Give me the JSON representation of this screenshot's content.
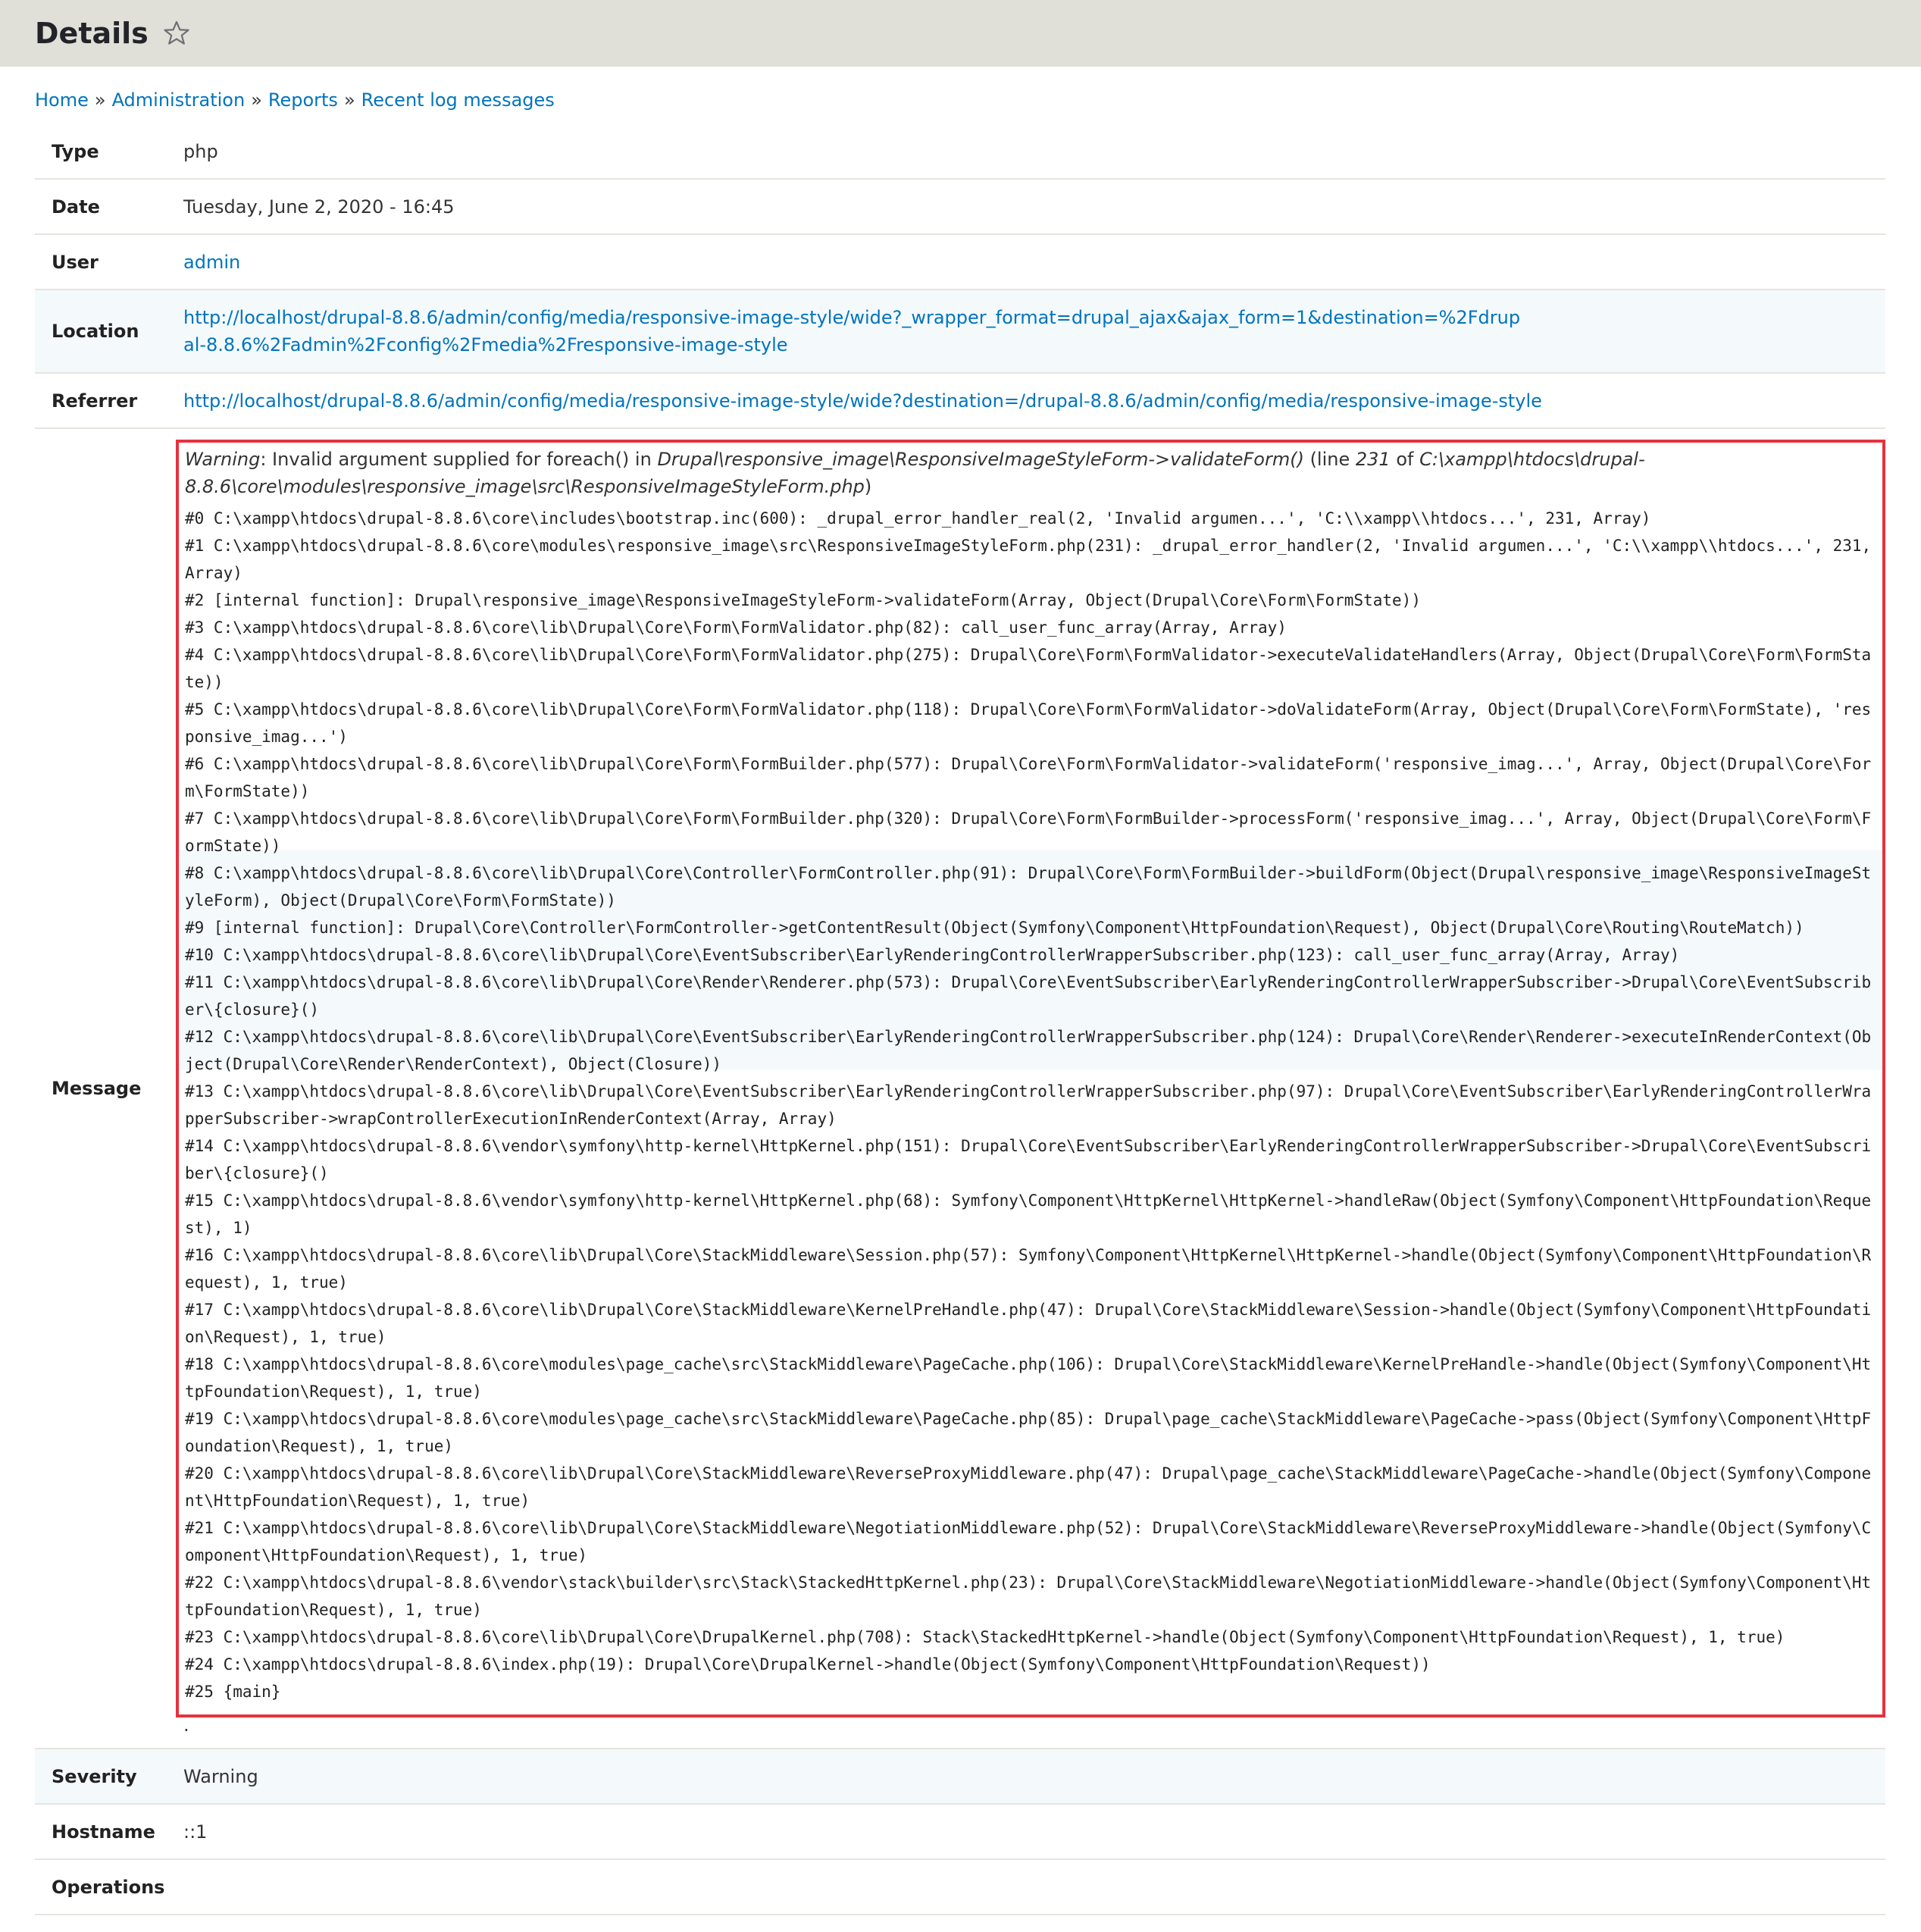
{
  "header": {
    "title": "Details",
    "star_icon": "star-outline-icon"
  },
  "breadcrumb": [
    "Home",
    "Administration",
    "Reports",
    "Recent log messages"
  ],
  "breadcrumb_sep": "»",
  "details": {
    "type": {
      "label": "Type",
      "value": "php"
    },
    "date": {
      "label": "Date",
      "value": "Tuesday, June 2, 2020 - 16:45"
    },
    "user": {
      "label": "User",
      "value": "admin"
    },
    "location": {
      "label": "Location",
      "value": "http://localhost/drupal-8.8.6/admin/config/media/responsive-image-style/wide?_wrapper_format=drupal_ajax&ajax_form=1&destination=%2Fdrupal-8.8.6%2Fadmin%2Fconfig%2Fmedia%2Fresponsive-image-style"
    },
    "referrer": {
      "label": "Referrer",
      "value": "http://localhost/drupal-8.8.6/admin/config/media/responsive-image-style/wide?destination=/drupal-8.8.6/admin/config/media/responsive-image-style"
    },
    "message": {
      "label": "Message",
      "warning_prefix": "Warning",
      "warning_text": ": Invalid argument supplied for foreach() in ",
      "warning_function": "Drupal\\responsive_image\\ResponsiveImageStyleForm->validateForm()",
      "warning_line_pre": " (line ",
      "warning_line": "231",
      "warning_of": " of ",
      "warning_file": "C:\\xampp\\htdocs\\drupal-8.8.6\\core\\modules\\responsive_image\\src\\ResponsiveImageStyleForm.php",
      "warning_close": ")",
      "trace": [
        "#0 C:\\xampp\\htdocs\\drupal-8.8.6\\core\\includes\\bootstrap.inc(600): _drupal_error_handler_real(2, 'Invalid argumen...', 'C:\\\\xampp\\\\htdocs...', 231, Array)",
        "#1 C:\\xampp\\htdocs\\drupal-8.8.6\\core\\modules\\responsive_image\\src\\ResponsiveImageStyleForm.php(231): _drupal_error_handler(2, 'Invalid argumen...', 'C:\\\\xampp\\\\htdocs...', 231, Array)",
        "#2 [internal function]: Drupal\\responsive_image\\ResponsiveImageStyleForm->validateForm(Array, Object(Drupal\\Core\\Form\\FormState))",
        "#3 C:\\xampp\\htdocs\\drupal-8.8.6\\core\\lib\\Drupal\\Core\\Form\\FormValidator.php(82): call_user_func_array(Array, Array)",
        "#4 C:\\xampp\\htdocs\\drupal-8.8.6\\core\\lib\\Drupal\\Core\\Form\\FormValidator.php(275): Drupal\\Core\\Form\\FormValidator->executeValidateHandlers(Array, Object(Drupal\\Core\\Form\\FormState))",
        "#5 C:\\xampp\\htdocs\\drupal-8.8.6\\core\\lib\\Drupal\\Core\\Form\\FormValidator.php(118): Drupal\\Core\\Form\\FormValidator->doValidateForm(Array, Object(Drupal\\Core\\Form\\FormState), 'responsive_imag...')",
        "#6 C:\\xampp\\htdocs\\drupal-8.8.6\\core\\lib\\Drupal\\Core\\Form\\FormBuilder.php(577): Drupal\\Core\\Form\\FormValidator->validateForm('responsive_imag...', Array, Object(Drupal\\Core\\Form\\FormState))",
        "#7 C:\\xampp\\htdocs\\drupal-8.8.6\\core\\lib\\Drupal\\Core\\Form\\FormBuilder.php(320): Drupal\\Core\\Form\\FormBuilder->processForm('responsive_imag...', Array, Object(Drupal\\Core\\Form\\FormState))",
        "#8 C:\\xampp\\htdocs\\drupal-8.8.6\\core\\lib\\Drupal\\Core\\Controller\\FormController.php(91): Drupal\\Core\\Form\\FormBuilder->buildForm(Object(Drupal\\responsive_image\\ResponsiveImageStyleForm), Object(Drupal\\Core\\Form\\FormState))",
        "#9 [internal function]: Drupal\\Core\\Controller\\FormController->getContentResult(Object(Symfony\\Component\\HttpFoundation\\Request), Object(Drupal\\Core\\Routing\\RouteMatch))",
        "#10 C:\\xampp\\htdocs\\drupal-8.8.6\\core\\lib\\Drupal\\Core\\EventSubscriber\\EarlyRenderingControllerWrapperSubscriber.php(123): call_user_func_array(Array, Array)",
        "#11 C:\\xampp\\htdocs\\drupal-8.8.6\\core\\lib\\Drupal\\Core\\Render\\Renderer.php(573): Drupal\\Core\\EventSubscriber\\EarlyRenderingControllerWrapperSubscriber->Drupal\\Core\\EventSubscriber\\{closure}()",
        "#12 C:\\xampp\\htdocs\\drupal-8.8.6\\core\\lib\\Drupal\\Core\\EventSubscriber\\EarlyRenderingControllerWrapperSubscriber.php(124): Drupal\\Core\\Render\\Renderer->executeInRenderContext(Object(Drupal\\Core\\Render\\RenderContext), Object(Closure))",
        "#13 C:\\xampp\\htdocs\\drupal-8.8.6\\core\\lib\\Drupal\\Core\\EventSubscriber\\EarlyRenderingControllerWrapperSubscriber.php(97): Drupal\\Core\\EventSubscriber\\EarlyRenderingControllerWrapperSubscriber->wrapControllerExecutionInRenderContext(Array, Array)",
        "#14 C:\\xampp\\htdocs\\drupal-8.8.6\\vendor\\symfony\\http-kernel\\HttpKernel.php(151): Drupal\\Core\\EventSubscriber\\EarlyRenderingControllerWrapperSubscriber->Drupal\\Core\\EventSubscriber\\{closure}()",
        "#15 C:\\xampp\\htdocs\\drupal-8.8.6\\vendor\\symfony\\http-kernel\\HttpKernel.php(68): Symfony\\Component\\HttpKernel\\HttpKernel->handleRaw(Object(Symfony\\Component\\HttpFoundation\\Request), 1)",
        "#16 C:\\xampp\\htdocs\\drupal-8.8.6\\core\\lib\\Drupal\\Core\\StackMiddleware\\Session.php(57): Symfony\\Component\\HttpKernel\\HttpKernel->handle(Object(Symfony\\Component\\HttpFoundation\\Request), 1, true)",
        "#17 C:\\xampp\\htdocs\\drupal-8.8.6\\core\\lib\\Drupal\\Core\\StackMiddleware\\KernelPreHandle.php(47): Drupal\\Core\\StackMiddleware\\Session->handle(Object(Symfony\\Component\\HttpFoundation\\Request), 1, true)",
        "#18 C:\\xampp\\htdocs\\drupal-8.8.6\\core\\modules\\page_cache\\src\\StackMiddleware\\PageCache.php(106): Drupal\\Core\\StackMiddleware\\KernelPreHandle->handle(Object(Symfony\\Component\\HttpFoundation\\Request), 1, true)",
        "#19 C:\\xampp\\htdocs\\drupal-8.8.6\\core\\modules\\page_cache\\src\\StackMiddleware\\PageCache.php(85): Drupal\\page_cache\\StackMiddleware\\PageCache->pass(Object(Symfony\\Component\\HttpFoundation\\Request), 1, true)",
        "#20 C:\\xampp\\htdocs\\drupal-8.8.6\\core\\lib\\Drupal\\Core\\StackMiddleware\\ReverseProxyMiddleware.php(47): Drupal\\page_cache\\StackMiddleware\\PageCache->handle(Object(Symfony\\Component\\HttpFoundation\\Request), 1, true)",
        "#21 C:\\xampp\\htdocs\\drupal-8.8.6\\core\\lib\\Drupal\\Core\\StackMiddleware\\NegotiationMiddleware.php(52): Drupal\\Core\\StackMiddleware\\ReverseProxyMiddleware->handle(Object(Symfony\\Component\\HttpFoundation\\Request), 1, true)",
        "#22 C:\\xampp\\htdocs\\drupal-8.8.6\\vendor\\stack\\builder\\src\\Stack\\StackedHttpKernel.php(23): Drupal\\Core\\StackMiddleware\\NegotiationMiddleware->handle(Object(Symfony\\Component\\HttpFoundation\\Request), 1, true)",
        "#23 C:\\xampp\\htdocs\\drupal-8.8.6\\core\\lib\\Drupal\\Core\\DrupalKernel.php(708): Stack\\StackedHttpKernel->handle(Object(Symfony\\Component\\HttpFoundation\\Request), 1, true)",
        "#24 C:\\xampp\\htdocs\\drupal-8.8.6\\index.php(19): Drupal\\Core\\DrupalKernel->handle(Object(Symfony\\Component\\HttpFoundation\\Request))",
        "#25 {main}"
      ],
      "trailing": "."
    },
    "severity": {
      "label": "Severity",
      "value": "Warning"
    },
    "hostname": {
      "label": "Hostname",
      "value": "::1"
    },
    "operations": {
      "label": "Operations",
      "value": ""
    }
  },
  "colors": {
    "header_bg": "#e0e0d8",
    "link": "#0074bd",
    "highlight_border": "#e5323e",
    "row_stripe": "#f4f9fc",
    "row_border": "#e6e4df"
  }
}
